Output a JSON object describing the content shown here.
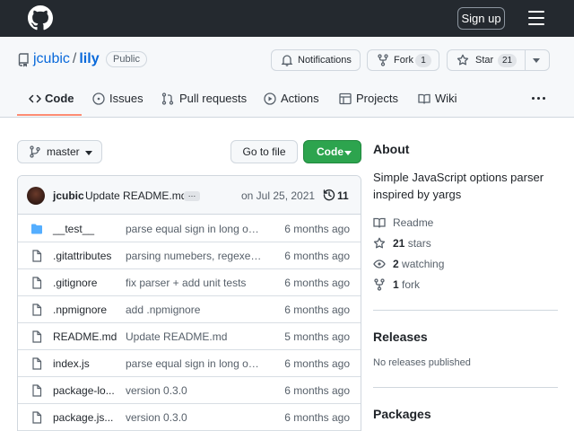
{
  "header": {
    "signup_label": "Sign up"
  },
  "repo": {
    "owner": "jcubic",
    "separator": "/",
    "name": "lily",
    "visibility": "Public",
    "notifications_label": "Notifications",
    "fork_label": "Fork",
    "fork_count": "1",
    "star_label": "Star",
    "star_count": "21"
  },
  "tabs": [
    {
      "label": "Code",
      "icon": "code-icon",
      "selected": true
    },
    {
      "label": "Issues",
      "icon": "issue-icon"
    },
    {
      "label": "Pull requests",
      "icon": "pull-request-icon"
    },
    {
      "label": "Actions",
      "icon": "play-icon"
    },
    {
      "label": "Projects",
      "icon": "table-icon"
    },
    {
      "label": "Wiki",
      "icon": "book-icon"
    }
  ],
  "toolbar": {
    "branch": "master",
    "goto_file": "Go to file",
    "code_button": "Code"
  },
  "commit": {
    "author": "jcubic",
    "message": "Update README.md",
    "more": "…",
    "date": "on Jul 25, 2021",
    "count": "11"
  },
  "files": [
    {
      "type": "folder",
      "name": "__test__",
      "message": "parse equal sign in long opti...",
      "age": "6 months ago"
    },
    {
      "type": "file",
      "name": ".gitattributes",
      "message": "parsing numebers, regexes ...",
      "age": "6 months ago"
    },
    {
      "type": "file",
      "name": ".gitignore",
      "message": "fix parser + add unit tests",
      "age": "6 months ago"
    },
    {
      "type": "file",
      "name": ".npmignore",
      "message": "add .npmignore",
      "age": "6 months ago"
    },
    {
      "type": "file",
      "name": "README.md",
      "message": "Update README.md",
      "age": "5 months ago"
    },
    {
      "type": "file",
      "name": "index.js",
      "message": "parse equal sign in long opti...",
      "age": "6 months ago"
    },
    {
      "type": "file",
      "name": "package-lo...",
      "message": "version 0.3.0",
      "age": "6 months ago"
    },
    {
      "type": "file",
      "name": "package.js...",
      "message": "version 0.3.0",
      "age": "6 months ago"
    }
  ],
  "about": {
    "heading": "About",
    "description": "Simple JavaScript options parser inspired by yargs",
    "readme": "Readme",
    "stars_count": "21",
    "stars_label": "stars",
    "watching_count": "2",
    "watching_label": "watching",
    "forks_count": "1",
    "forks_label": "fork"
  },
  "releases": {
    "heading": "Releases",
    "empty": "No releases published"
  },
  "packages": {
    "heading": "Packages"
  },
  "colors": {
    "topbar": "#24292f",
    "link": "#0969da",
    "code_button": "#2da44e",
    "tab_underline": "#fd8c73",
    "folder": "#54aeff"
  }
}
